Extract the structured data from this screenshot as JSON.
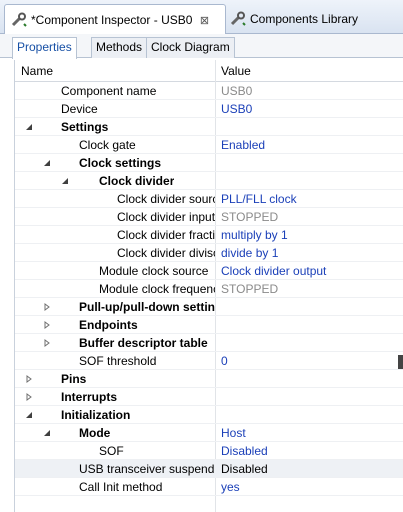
{
  "editor_tabs": [
    {
      "label": "*Component Inspector - USB0",
      "close": "⊠",
      "icon": "wrench-icon"
    },
    {
      "label": "Components Library",
      "icon": "wrench-icon"
    }
  ],
  "view_tabs": [
    "Properties",
    "Methods",
    "Clock Diagram"
  ],
  "columns": {
    "name": "Name",
    "value": "Value"
  },
  "rows": [
    {
      "name": "Component name",
      "value": "USB0"
    },
    {
      "name": "Device",
      "value": "USB0"
    },
    {
      "name": "Settings",
      "value": ""
    },
    {
      "name": "Clock gate",
      "value": "Enabled"
    },
    {
      "name": "Clock settings",
      "value": ""
    },
    {
      "name": "Clock divider",
      "value": ""
    },
    {
      "name": "Clock divider source",
      "value": "PLL/FLL clock"
    },
    {
      "name": "Clock divider input frequency",
      "value": "STOPPED"
    },
    {
      "name": "Clock divider fraction",
      "value": "multiply by 1"
    },
    {
      "name": "Clock divider divisor",
      "value": "divide by 1"
    },
    {
      "name": "Module clock source",
      "value": "Clock divider output"
    },
    {
      "name": "Module clock frequency",
      "value": "STOPPED"
    },
    {
      "name": "Pull-up/pull-down settings",
      "value": ""
    },
    {
      "name": "Endpoints",
      "value": ""
    },
    {
      "name": "Buffer descriptor table",
      "value": ""
    },
    {
      "name": "SOF threshold",
      "value": "0"
    },
    {
      "name": "Pins",
      "value": ""
    },
    {
      "name": "Interrupts",
      "value": ""
    },
    {
      "name": "Initialization",
      "value": ""
    },
    {
      "name": "Mode",
      "value": "Host"
    },
    {
      "name": "SOF",
      "value": "Disabled"
    },
    {
      "name": "USB transceiver suspend state",
      "value": "Disabled"
    },
    {
      "name": "Call Init method",
      "value": "yes"
    }
  ]
}
